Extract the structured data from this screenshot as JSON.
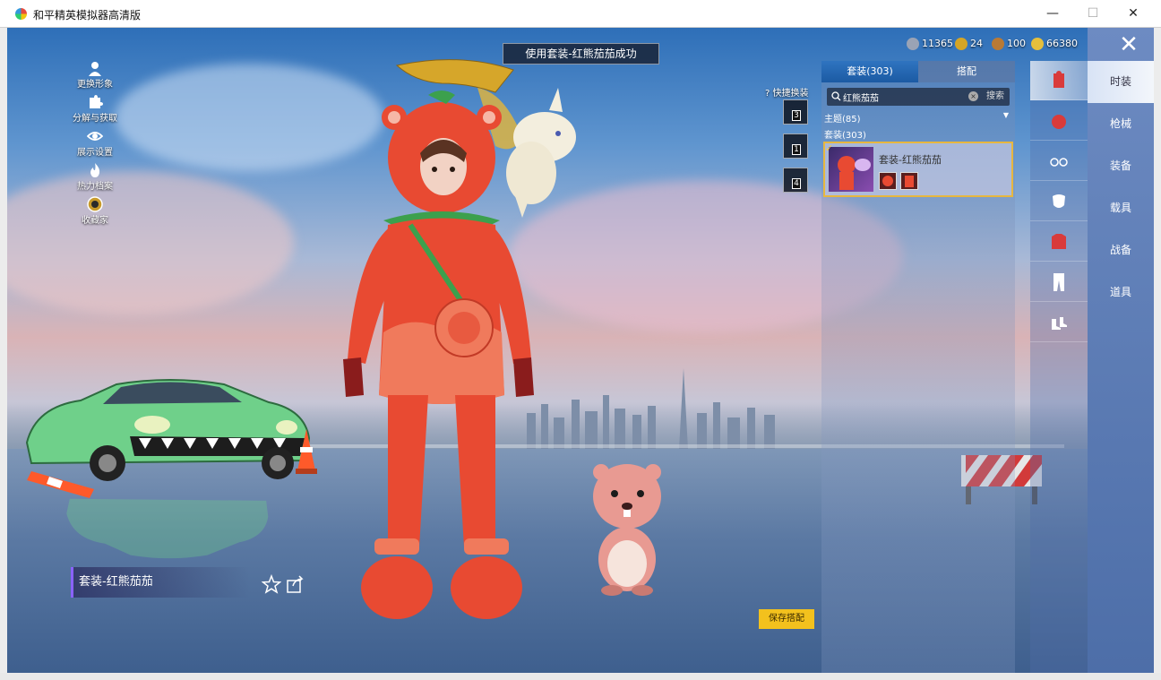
{
  "window": {
    "title": "和平精英模拟器高清版",
    "minimize_glyph": "—",
    "maximize_glyph": "☐",
    "close_glyph": "✕"
  },
  "toast": {
    "text": "使用套装-红熊茄茄成功"
  },
  "left_menu": [
    {
      "label": "更换形象",
      "icon": "person-icon"
    },
    {
      "label": "分解与获取",
      "icon": "puzzle-icon"
    },
    {
      "label": "展示设置",
      "icon": "eye-icon"
    },
    {
      "label": "热力档案",
      "icon": "flame-icon"
    },
    {
      "label": "收藏家",
      "icon": "collector-badge-icon"
    }
  ],
  "currencies": [
    {
      "value": "11365",
      "icon": "silver-coin-icon",
      "color": "#9aa3b5"
    },
    {
      "value": "24",
      "icon": "gold-badge-icon",
      "color": "#d5a526"
    },
    {
      "value": "100",
      "icon": "bronze-coin-icon",
      "color": "#b97a35"
    },
    {
      "value": "66380",
      "icon": "gold-coin-icon",
      "color": "#e5bf3c"
    }
  ],
  "quick_swap": {
    "label": "快捷换装",
    "slots": [
      "3",
      "1",
      "4"
    ]
  },
  "panel": {
    "tabs": [
      {
        "label": "套装(303)",
        "active": true
      },
      {
        "label": "搭配",
        "active": false
      }
    ],
    "search": {
      "value": "红熊茄茄",
      "button": "搜索"
    },
    "theme_filter": "主题(85)",
    "set_count": "套装(303)",
    "card": {
      "title": "套装-红熊茄茄",
      "checked": true
    }
  },
  "categories": [
    {
      "label": "时装",
      "active": true
    },
    {
      "label": "枪械",
      "active": false
    },
    {
      "label": "装备",
      "active": false
    },
    {
      "label": "载具",
      "active": false
    },
    {
      "label": "战备",
      "active": false
    },
    {
      "label": "道具",
      "active": false
    }
  ],
  "rail_icons": [
    "outfit-set-icon",
    "hat-icon",
    "glasses-icon",
    "mask-icon",
    "jacket-icon",
    "pants-icon",
    "shoes-icon"
  ],
  "outfit_name": "套装-红熊茄茄",
  "save_button": "保存搭配",
  "colors": {
    "accent_blue": "#1b5aa3",
    "card_border": "#e7b73f",
    "save_button": "#f3c11d",
    "outfit_accent": "#8a63ff"
  }
}
